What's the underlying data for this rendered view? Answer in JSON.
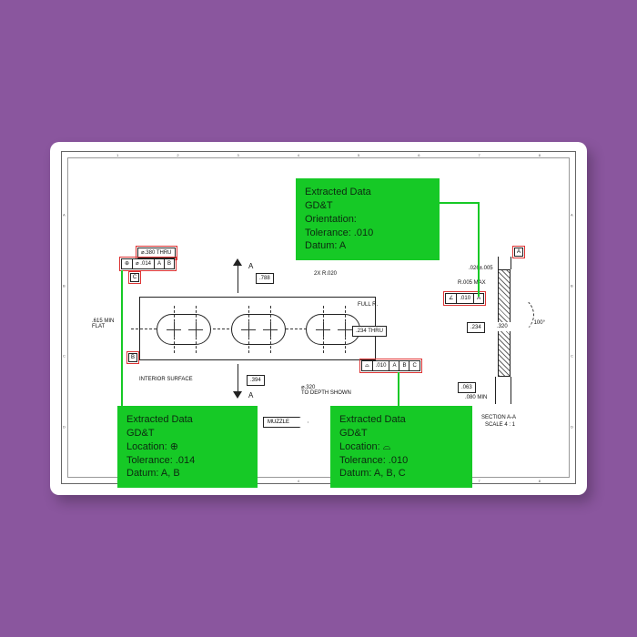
{
  "border": {
    "cols": [
      "1",
      "2",
      "3",
      "4",
      "5",
      "6",
      "7",
      "8"
    ],
    "rows": [
      "A",
      "B",
      "C",
      "D"
    ]
  },
  "muzzle": "MUZZLE",
  "callouts": {
    "top": {
      "title": "Extracted Data",
      "group": "GD&T",
      "lines": [
        "Orientation:",
        "Tolerance: .010",
        "Datum: A"
      ]
    },
    "left": {
      "title": "Extracted Data",
      "group": "GD&T",
      "lines": [
        "Location: ⊕",
        "Tolerance: .014",
        "Datum: A, B"
      ]
    },
    "right": {
      "title": "Extracted Data",
      "group": "GD&T",
      "lines": [
        "Location: ⌓",
        "Tolerance: .010",
        "Datum: A, B, C"
      ]
    }
  },
  "fcf": {
    "top_dia": "⌀.380 THRU",
    "top_frame": [
      "⊕",
      "⌀ .014",
      "A",
      "B"
    ],
    "top_c": "C",
    "right_angle_frame": [
      "∠",
      ".010",
      "A"
    ],
    "surf_frame": [
      "⌓",
      ".010",
      "A",
      "B",
      "C"
    ],
    "datum_a": "A",
    "datum_b": "B"
  },
  "dims": {
    "d788": ".788",
    "r020": "2X  R.020",
    "full_r": "FULL R.",
    "d234_thru": ".234 THRU",
    "d394": ".394",
    "d320_depth": "⌀.320\nTO DEPTH SHOWN",
    "interior": "INTERIOR SURFACE",
    "d615": ".615 MIN\nFLAT",
    "sect_a_top": "A",
    "sect_a_bot": "A",
    "d026": ".026±.005",
    "r005": "R.005 MAX",
    "d234": ".234",
    "d320": ".320",
    "ang100": "100°",
    "d063": ".063",
    "d080": ".080 MIN",
    "sect_title": "SECTION A-A",
    "sect_scale": "SCALE 4 : 1"
  }
}
